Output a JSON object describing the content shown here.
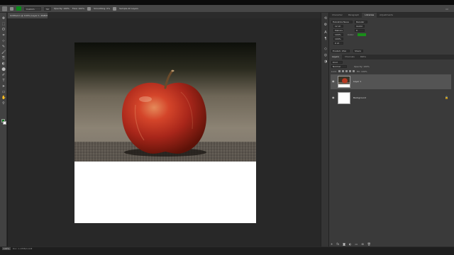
{
  "options_bar": {
    "tool_preset": "Custom",
    "flow": "Flow: 100%",
    "opacity": "Opacity: 100%",
    "smoothing": "Smoothing: 0%",
    "sample": "Sample All Layers",
    "brush_size": "50",
    "fill_color": "#0a8a1a"
  },
  "document": {
    "tab_title": "Untitled-1 @ 100% (Layer 1, RGB/8#) *"
  },
  "toolbar": {
    "tools": [
      "✥",
      "⬚",
      "ʘ",
      "⌗",
      "⊹",
      "✎",
      "🖌",
      "⎘",
      "◐",
      "⬤",
      "✐",
      "T",
      "➤",
      "▭",
      "✋",
      "⚲"
    ],
    "foreground_color": "#0a7a1a",
    "background_color": "#ffffff"
  },
  "status": {
    "zoom": "100%",
    "doc_info": "Doc: 1.07M/2.11M"
  },
  "panels": {
    "top_tabs": [
      "Character",
      "Paragraph",
      "Libraries",
      "Adjustments"
    ],
    "character": {
      "font_family": "Helvetica Neue",
      "font_style": "Regular",
      "size": "12 pt",
      "leading": "(Auto)",
      "tracking": "0",
      "kerning": "Metrics",
      "vertical_scale": "100%",
      "horizontal_scale": "100%",
      "baseline": "0 pt",
      "color_label": "Color:",
      "color": "#1a8f1a",
      "language": "English: USA",
      "antialias": "Sharp"
    },
    "layer_tabs": [
      "Layers",
      "Channels",
      "Paths"
    ],
    "layers_filter": "Kind",
    "blend_mode": "Normal",
    "opacity": "Opacity: 100%",
    "lock_label": "Lock:",
    "fill": "Fill: 100%",
    "layers": [
      {
        "name": "Layer 1",
        "selected": true
      },
      {
        "name": "Background",
        "selected": false
      }
    ]
  }
}
